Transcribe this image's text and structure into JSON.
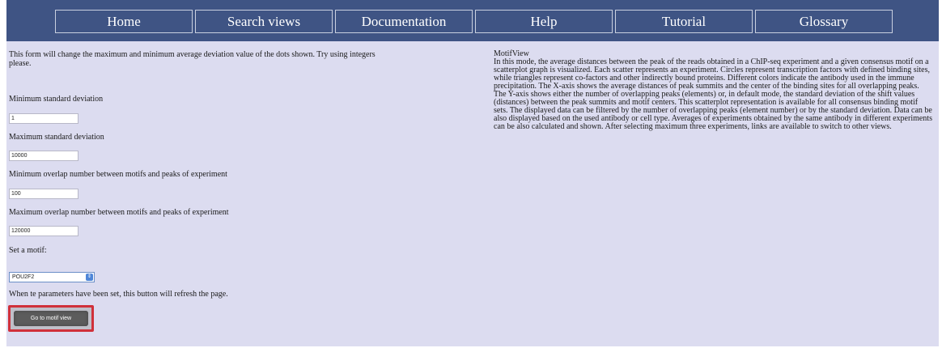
{
  "nav": {
    "items": [
      {
        "label": "Home"
      },
      {
        "label": "Search views"
      },
      {
        "label": "Documentation"
      },
      {
        "label": "Help"
      },
      {
        "label": "Tutorial"
      },
      {
        "label": "Glossary"
      }
    ]
  },
  "form": {
    "intro": "This form will change the maximum and minimum average deviation value of the dots shown. Try using integers please.",
    "min_std_label": "Minimum standard deviation",
    "min_std_value": "1",
    "max_std_label": "Maximum standard deviation",
    "max_std_value": "10000",
    "min_overlap_label": "Minimum overlap number between motifs and peaks of experiment",
    "min_overlap_value": "100",
    "max_overlap_label": "Maximum overlap number between motifs and peaks of experiment",
    "max_overlap_value": "120000",
    "motif_label": "Set a motif:",
    "motif_value": "POU2F2",
    "refresh_note": "When te parameters have been set, this button will refresh the page.",
    "button_label": "Go to motif view"
  },
  "description": {
    "title": "MotifView",
    "body": "In this mode, the average distances between the peak of the reads obtained in a ChIP-seq experiment and a given consensus motif on a scatterplot graph is visualized. Each scatter represents an experiment. Circles represent transcription factors with defined binding sites, while triangles represent co-factors and other indirectly bound proteins. Different colors indicate the antibody used in the immune precipitation. The X-axis shows the average distances of peak summits and the center of the binding sites for all overlapping peaks. The Y-axis shows either the number of overlapping peaks (elements) or, in default mode, the standard deviation of the shift values (distances) between the peak summits and motif centers. This scatterplot representation is available for all consensus binding motif sets. The displayed data can be filtered by the number of overlapping peaks (element number) or by the standard deviation. Data can be also displayed based on the used antibody or cell type. Averages of experiments obtained by the same antibody in different experiments can be also calculated and shown. After selecting maximum three experiments, links are available to switch to other views."
  },
  "colors": {
    "nav_bg": "#3f5484",
    "content_bg": "#dcdcf0",
    "highlight": "#d0303a"
  }
}
